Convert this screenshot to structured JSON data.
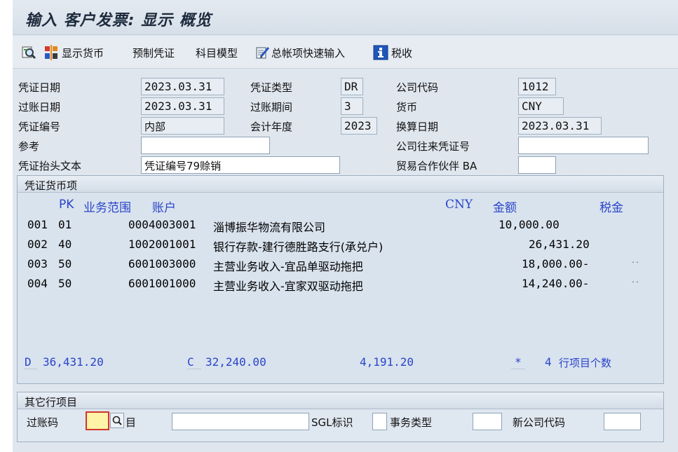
{
  "title": "输入 客户发票: 显示 概览",
  "toolbar": {
    "display_currency": "显示货币",
    "park": "预制凭证",
    "acct_model": "科目模型",
    "fast_entry": "总帐项快速输入",
    "tax": "税收"
  },
  "header": {
    "doc_date_label": "凭证日期",
    "doc_date": "2023.03.31",
    "doc_type_label": "凭证类型",
    "doc_type": "DR",
    "company_code_label": "公司代码",
    "company_code": "1012",
    "posting_date_label": "过账日期",
    "posting_date": "2023.03.31",
    "period_label": "过账期间",
    "period": "3",
    "currency_label": "货币",
    "currency": "CNY",
    "doc_number_label": "凭证编号",
    "doc_number": "内部",
    "fiscal_year_label": "会计年度",
    "fiscal_year": "2023",
    "translation_date_label": "换算日期",
    "translation_date": "2023.03.31",
    "reference_label": "参考",
    "reference": "",
    "intercompany_label": "公司往来凭证号",
    "intercompany": "",
    "header_text_label": "凭证抬头文本",
    "header_text": "凭证编号79赊销",
    "trading_partner_label": "贸易合作伙伴 BA",
    "trading_partner": ""
  },
  "items_group": {
    "title": "凭证货币项",
    "col_pk": "PK",
    "col_ba": "业务范围",
    "col_account": "账户",
    "col_cny": "CNY",
    "col_amount": "金额",
    "col_tax": "税金",
    "rows": [
      {
        "no": "001",
        "pk": "01",
        "account": "0004003001",
        "text": "淄博振华物流有限公司",
        "amount": "10,000.00",
        "mark": ""
      },
      {
        "no": "002",
        "pk": "40",
        "account": "1002001001",
        "text": "银行存款-建行德胜路支行(承兑户)",
        "amount": "26,431.20",
        "mark": ""
      },
      {
        "no": "003",
        "pk": "50",
        "account": "6001003000",
        "text": "主营业务收入-宜品单驱动拖把",
        "amount": "18,000.00-",
        "mark": ".."
      },
      {
        "no": "004",
        "pk": "50",
        "account": "6001001000",
        "text": "主营业务收入-宜家双驱动拖把",
        "amount": "14,240.00-",
        "mark": ".."
      }
    ],
    "debit_label": "D",
    "debit_total": "36,431.20",
    "credit_label": "C",
    "credit_total": "32,240.00",
    "balance": "4,191.20",
    "star": "*",
    "line_count": "4",
    "line_count_label": "行项目个数"
  },
  "other_group": {
    "title": "其它行项目",
    "posting_key_label": "过账码",
    "posting_key": "",
    "account_label": "目",
    "account": "",
    "sgl_label": "SGL标识",
    "sgl": "",
    "txn_type_label": "事务类型",
    "txn_type": "",
    "new_cc_label": "新公司代码",
    "new_cc": ""
  }
}
